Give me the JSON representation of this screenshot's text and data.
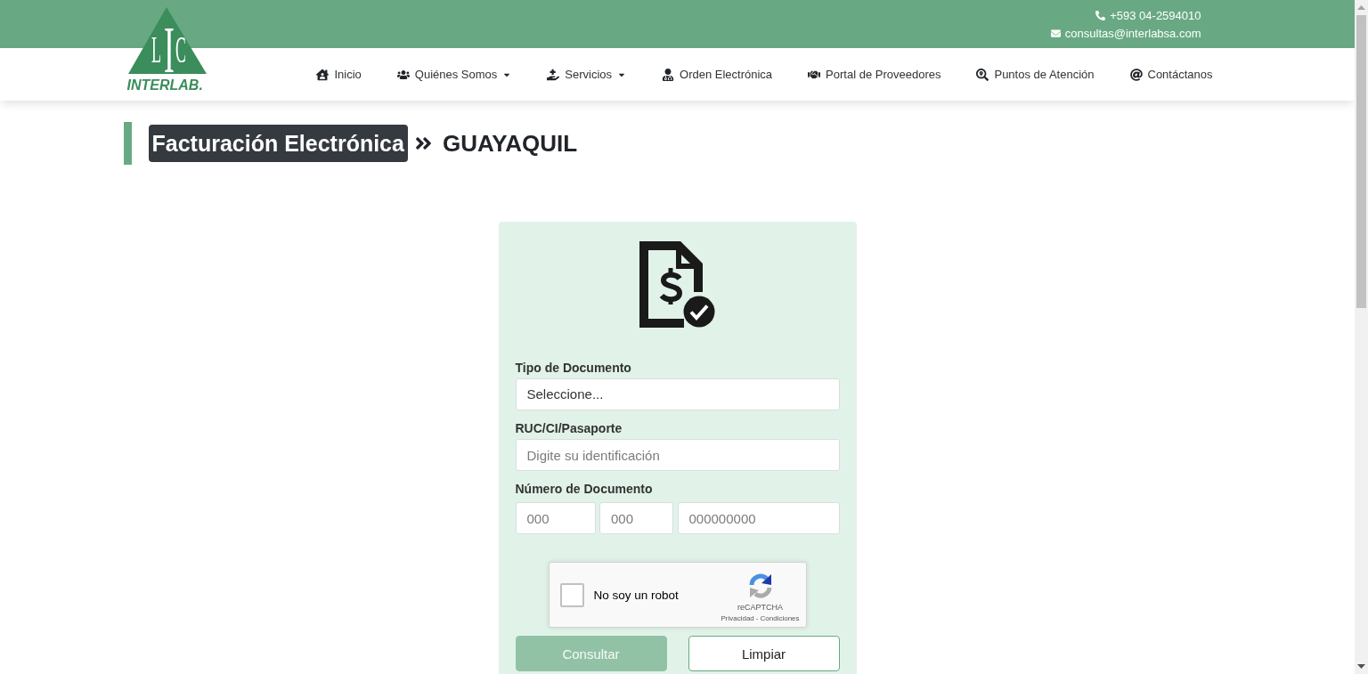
{
  "top_bar": {
    "phone": "+593 04-2594010",
    "email": "consultas@interlabsa.com"
  },
  "logo": {
    "letters": [
      "L",
      "I",
      "C"
    ],
    "wordmark": "INTERLAB."
  },
  "nav": [
    {
      "label": "Inicio",
      "has_menu": false
    },
    {
      "label": "Quiénes Somos",
      "has_menu": true
    },
    {
      "label": "Servicios",
      "has_menu": true
    },
    {
      "label": "Orden Electrónica",
      "has_menu": false
    },
    {
      "label": "Portal de Proveedores",
      "has_menu": false
    },
    {
      "label": "Puntos de Atención",
      "has_menu": false
    },
    {
      "label": "Contáctanos",
      "has_menu": false
    }
  ],
  "heading": {
    "section": "Facturación Electrónica",
    "city": "GUAYAQUIL"
  },
  "form": {
    "fields": [
      {
        "kind": "select",
        "label": "Tipo de Documento",
        "value": "Seleccione..."
      },
      {
        "kind": "text",
        "label": "RUC/CI/Pasaporte",
        "placeholder": "Digite su identificación"
      },
      {
        "kind": "split",
        "label": "Número de Documento",
        "parts": [
          {
            "placeholder": "000"
          },
          {
            "placeholder": "000"
          },
          {
            "placeholder": "000000000"
          }
        ]
      }
    ],
    "captcha": {
      "checked": false,
      "label": "No soy un robot",
      "brand": "reCAPTCHA",
      "links": [
        "Privacidad",
        "Condiciones"
      ],
      "separator": "-"
    },
    "buttons": [
      {
        "kind": "primary",
        "label": "Consultar",
        "disabled": true
      },
      {
        "kind": "outline",
        "label": "Limpiar",
        "disabled": false
      }
    ]
  }
}
